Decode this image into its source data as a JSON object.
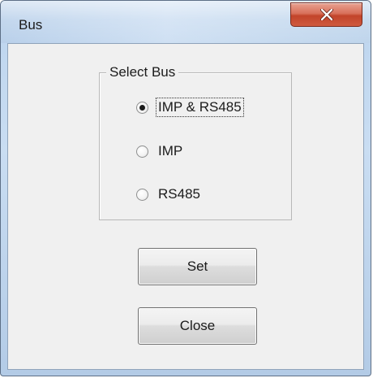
{
  "window": {
    "title": "Bus",
    "close_icon": "close-x-icon"
  },
  "group": {
    "legend": "Select Bus",
    "options": [
      {
        "label": "IMP & RS485",
        "checked": true
      },
      {
        "label": "IMP",
        "checked": false
      },
      {
        "label": "RS485",
        "checked": false
      }
    ]
  },
  "buttons": {
    "set_label": "Set",
    "close_label": "Close"
  },
  "colors": {
    "close_button": "#c2442a",
    "client_background": "#f0f0f0",
    "titlebar": "#c9ddf2"
  }
}
